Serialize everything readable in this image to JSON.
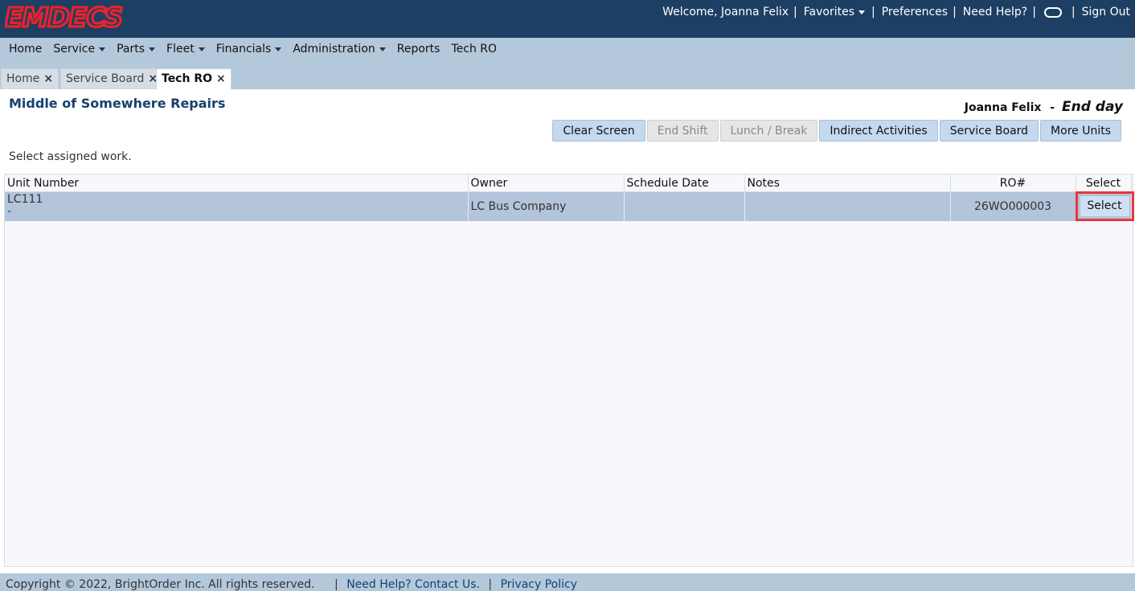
{
  "app": {
    "logo_text": "EMDECS",
    "brand_color": "#e8232a"
  },
  "header": {
    "welcome": "Welcome, Joanna Felix",
    "favorites": "Favorites",
    "preferences": "Preferences",
    "need_help": "Need Help?",
    "sign_out": "Sign Out",
    "sep": "|"
  },
  "nav": {
    "items": [
      {
        "label": "Home"
      },
      {
        "label": "Service"
      },
      {
        "label": "Parts"
      },
      {
        "label": "Fleet"
      },
      {
        "label": "Financials"
      },
      {
        "label": "Administration"
      },
      {
        "label": "Reports"
      },
      {
        "label": "Tech RO"
      }
    ]
  },
  "tabs": [
    {
      "label": "Home"
    },
    {
      "label": "Service Board"
    },
    {
      "label": "Tech RO"
    }
  ],
  "tab_close": "×",
  "page": {
    "shop_title": "Middle of Somewhere Repairs",
    "user_name": "Joanna Felix",
    "dash": "-",
    "status": "End day",
    "instruction": "Select assigned work."
  },
  "buttons": {
    "clear_screen": "Clear Screen",
    "end_shift": "End Shift",
    "lunch_break": "Lunch / Break",
    "indirect_activities": "Indirect Activities",
    "service_board": "Service Board",
    "more_units": "More Units"
  },
  "table": {
    "columns": [
      "Unit Number",
      "Owner",
      "Schedule Date",
      "Notes",
      "RO#",
      "Select"
    ],
    "rows": [
      {
        "unit_number": "LC111",
        "unit_sub": "-",
        "owner": "LC Bus Company",
        "schedule_date": "",
        "notes": "",
        "ro": "26WO000003",
        "select_label": "Select"
      }
    ]
  },
  "footer": {
    "copyright": "Copyright © 2022, BrightOrder Inc. All rights reserved.",
    "sep": "|",
    "help_link": "Need Help? Contact Us.",
    "privacy_link": "Privacy Policy"
  }
}
